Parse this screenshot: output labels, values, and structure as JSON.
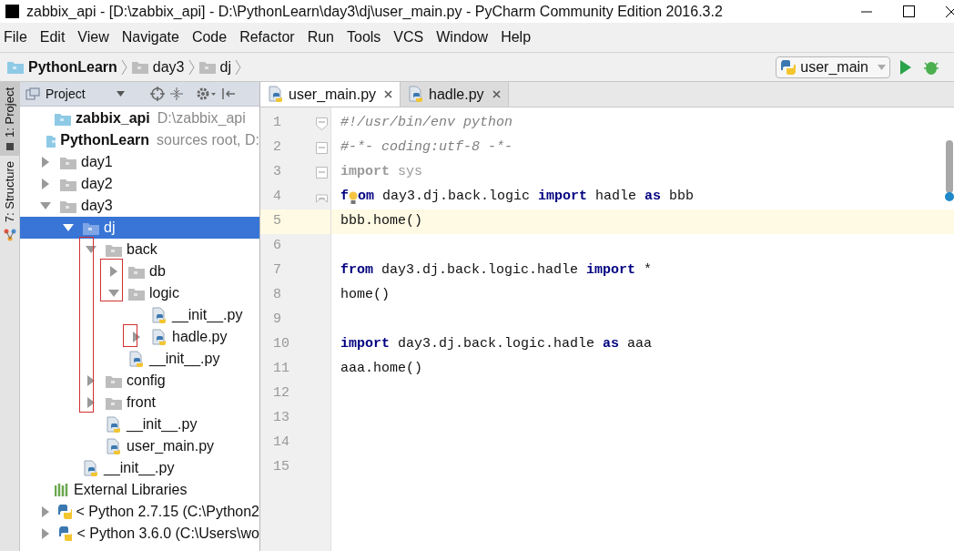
{
  "window": {
    "title": "zabbix_api - [D:\\zabbix_api] - D:\\PythonLearn\\day3\\dj\\user_main.py - PyCharm Community Edition 2016.3.2"
  },
  "menu": [
    "File",
    "Edit",
    "View",
    "Navigate",
    "Code",
    "Refactor",
    "Run",
    "Tools",
    "VCS",
    "Window",
    "Help"
  ],
  "breadcrumbs": [
    {
      "label": "PythonLearn",
      "kind": "root"
    },
    {
      "label": "day3",
      "kind": "folder"
    },
    {
      "label": "dj",
      "kind": "folder"
    }
  ],
  "run_config": {
    "label": "user_main"
  },
  "tool_strip": [
    {
      "label": "1: Project",
      "selected": true
    },
    {
      "label": "7: Structure",
      "selected": false
    }
  ],
  "project_panel": {
    "title": "Project"
  },
  "tree": [
    {
      "label": "zabbix_api",
      "kind": "root",
      "note": "D:\\zabbix_api"
    },
    {
      "label": "PythonLearn",
      "kind": "root",
      "note": "sources root,  D:",
      "children": [
        {
          "label": "day1",
          "kind": "folder",
          "expanded": false,
          "selected": false
        },
        {
          "label": "day2",
          "kind": "folder",
          "expanded": false,
          "selected": false
        },
        {
          "label": "day3",
          "kind": "folder",
          "expanded": true,
          "selected": false,
          "children": [
            {
              "label": "dj",
              "kind": "folder",
              "expanded": true,
              "selected": true,
              "children": [
                {
                  "label": "back",
                  "kind": "folder",
                  "expanded": true,
                  "selected": false,
                  "children": [
                    {
                      "label": "db",
                      "kind": "folder",
                      "expanded": false,
                      "selected": false
                    },
                    {
                      "label": "logic",
                      "kind": "folder",
                      "expanded": true,
                      "selected": false,
                      "children": [
                        {
                          "label": "__init__.py",
                          "kind": "python",
                          "selected": false
                        },
                        {
                          "label": "hadle.py",
                          "kind": "python",
                          "expanded": false,
                          "selected": false
                        }
                      ]
                    },
                    {
                      "label": "__init__.py",
                      "kind": "python",
                      "selected": false
                    }
                  ]
                },
                {
                  "label": "config",
                  "kind": "folder",
                  "expanded": false,
                  "selected": false
                },
                {
                  "label": "front",
                  "kind": "folder",
                  "expanded": false,
                  "selected": false
                },
                {
                  "label": "__init__.py",
                  "kind": "python",
                  "selected": false
                },
                {
                  "label": "user_main.py",
                  "kind": "python",
                  "selected": false
                }
              ]
            },
            {
              "label": "__init__.py",
              "kind": "python",
              "selected": false
            }
          ]
        }
      ]
    },
    {
      "label": "External Libraries",
      "kind": "libraries",
      "children": [
        {
          "label": "< Python 2.7.15 (C:\\Python2",
          "kind": "sdk",
          "expanded": false,
          "selected": false
        },
        {
          "label": "< Python 3.6.0 (C:\\Users\\wo",
          "kind": "sdk",
          "expanded": false,
          "selected": false
        }
      ]
    }
  ],
  "tabs": [
    {
      "label": "user_main.py",
      "selected": true
    },
    {
      "label": "hadle.py",
      "selected": false
    }
  ],
  "editor": {
    "lines": [
      {
        "number": "1",
        "current": false,
        "tokens": [
          {
            "kind": "comment",
            "text": "#!/usr/bin/env python"
          }
        ]
      },
      {
        "number": "2",
        "current": false,
        "tokens": [
          {
            "kind": "comment",
            "text": "#-*- coding:utf-8 -*-"
          }
        ]
      },
      {
        "number": "3",
        "current": false,
        "tokens": [
          {
            "kind": "unused",
            "text": "import"
          },
          {
            "kind": "dim",
            "text": " sys"
          }
        ]
      },
      {
        "number": "4",
        "current": false,
        "bulb": true,
        "tokens": [
          {
            "kind": "keyword",
            "text": "f"
          },
          {
            "kind": "keyword",
            "text": "om"
          },
          {
            "kind": "plain",
            "text": " day3.dj.back.logic "
          },
          {
            "kind": "keyword",
            "text": "import"
          },
          {
            "kind": "plain",
            "text": " hadle "
          },
          {
            "kind": "keyword",
            "text": "as"
          },
          {
            "kind": "plain",
            "text": " bbb"
          }
        ]
      },
      {
        "number": "5",
        "current": true,
        "tokens": [
          {
            "kind": "plain",
            "text": "bbb.home()"
          }
        ]
      },
      {
        "number": "6",
        "current": false
      },
      {
        "number": "7",
        "current": false,
        "tokens": [
          {
            "kind": "keyword",
            "text": "from"
          },
          {
            "kind": "plain",
            "text": " day3.dj.back.logic.hadle "
          },
          {
            "kind": "keyword",
            "text": "import"
          },
          {
            "kind": "plain",
            "text": " *"
          }
        ]
      },
      {
        "number": "8",
        "current": false,
        "tokens": [
          {
            "kind": "plain",
            "text": "home()"
          }
        ]
      },
      {
        "number": "9",
        "current": false
      },
      {
        "number": "10",
        "current": false,
        "tokens": [
          {
            "kind": "keyword",
            "text": "import"
          },
          {
            "kind": "plain",
            "text": " day3.dj.back.logic.hadle "
          },
          {
            "kind": "keyword",
            "text": "as"
          },
          {
            "kind": "plain",
            "text": " aaa"
          }
        ]
      },
      {
        "number": "11",
        "current": false,
        "tokens": [
          {
            "kind": "plain",
            "text": "aaa.home()"
          }
        ]
      },
      {
        "number": "12",
        "current": false
      },
      {
        "number": "13",
        "current": false
      },
      {
        "number": "14",
        "current": false
      },
      {
        "number": "15",
        "current": false
      }
    ]
  }
}
